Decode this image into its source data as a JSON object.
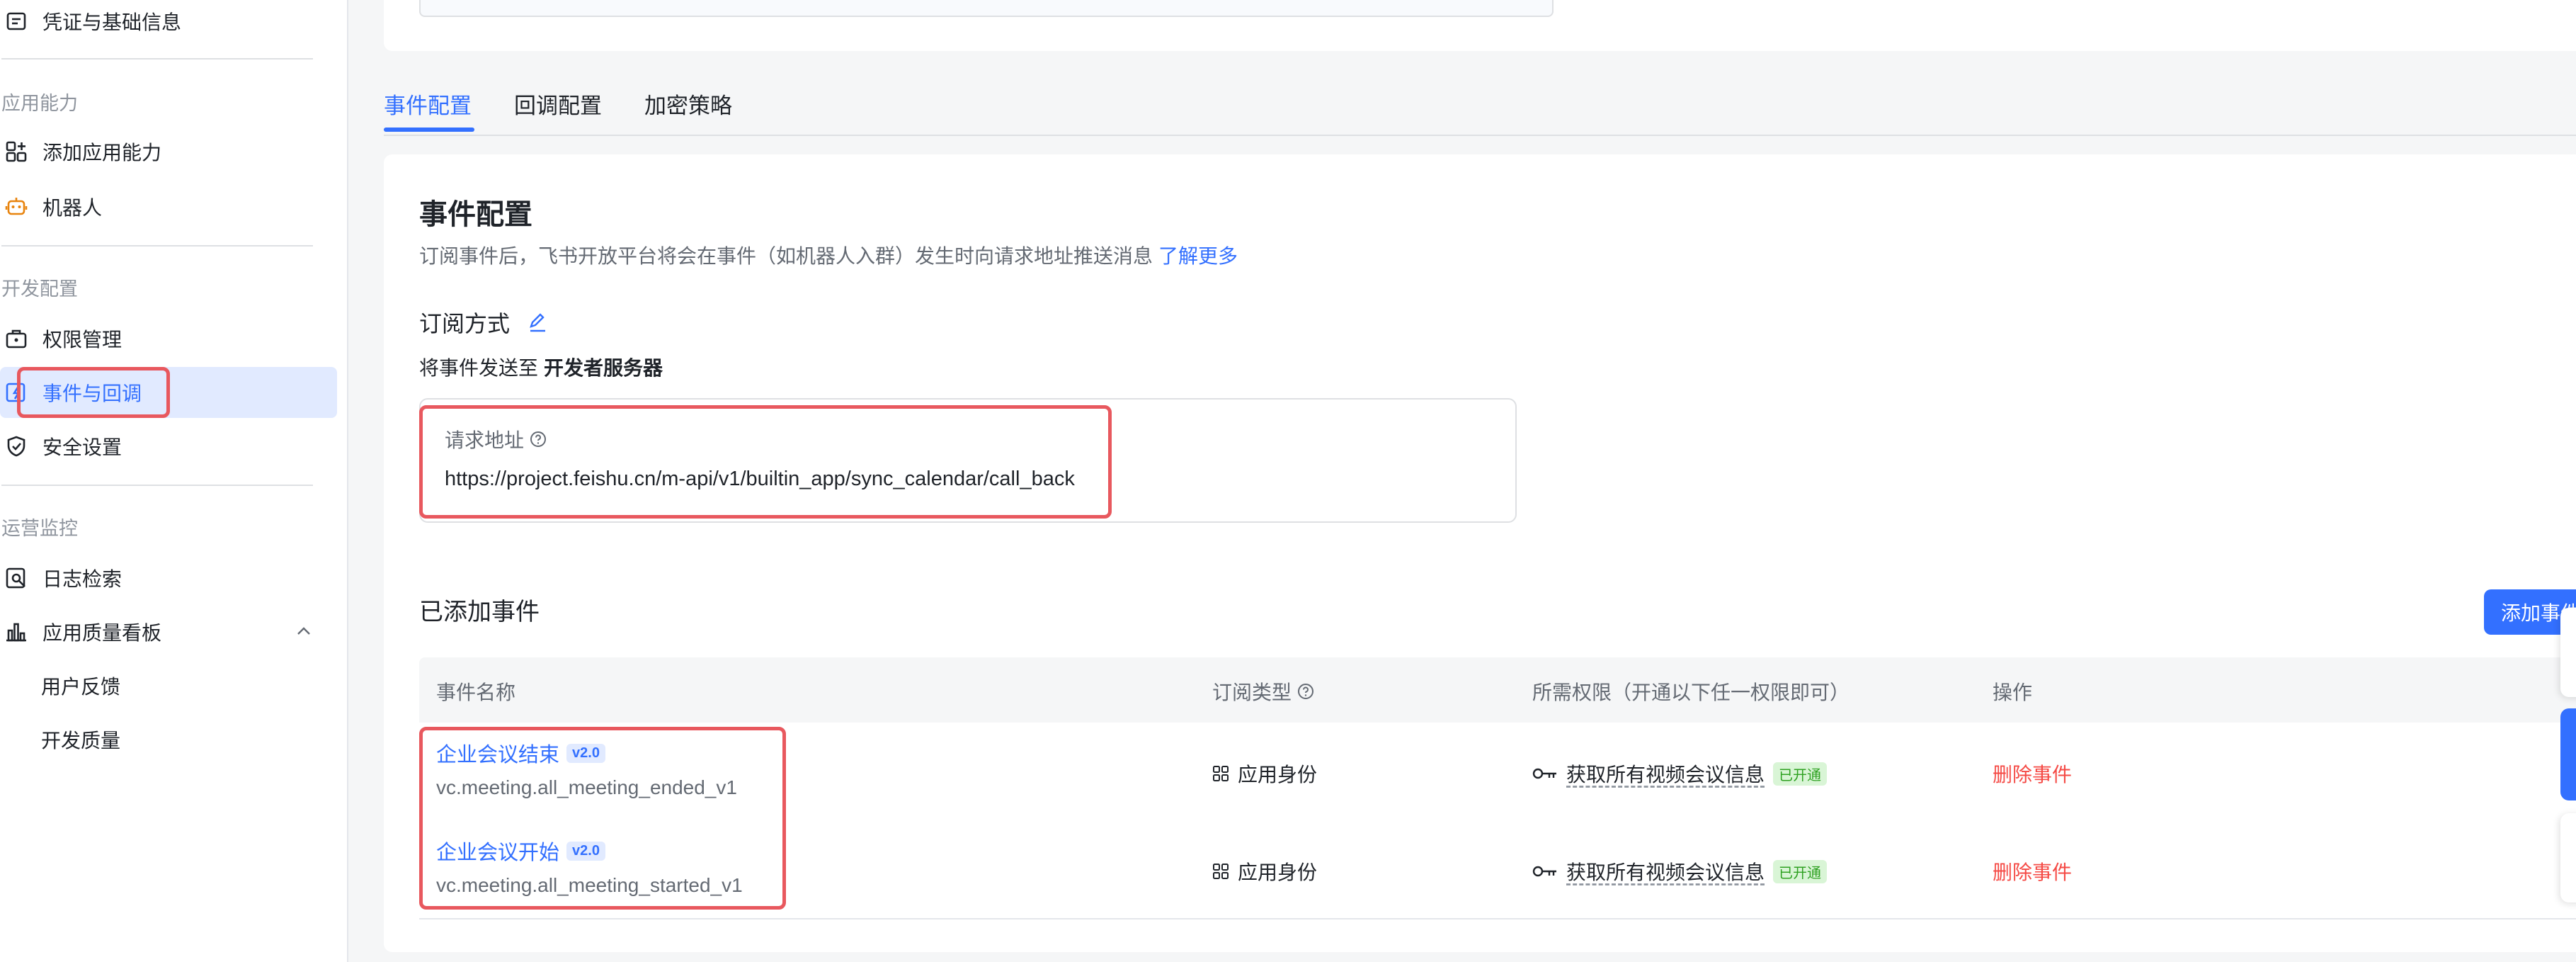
{
  "sidebar": {
    "top_item": "凭证与基础信息",
    "groups": [
      {
        "label": "应用能力",
        "items": [
          "添加应用能力",
          "机器人"
        ]
      },
      {
        "label": "开发配置",
        "items": [
          "权限管理",
          "事件与回调",
          "安全设置"
        ]
      },
      {
        "label": "运营监控",
        "items": [
          "日志检索",
          "应用质量看板",
          "用户反馈",
          "开发质量"
        ]
      }
    ],
    "active_item": "事件与回调"
  },
  "tabs": [
    "事件配置",
    "回调配置",
    "加密策略"
  ],
  "active_tab": "事件配置",
  "section": {
    "title": "事件配置",
    "description": "订阅事件后，飞书开放平台将会在事件（如机器人入群）发生时向请求地址推送消息",
    "learn_more": "了解更多",
    "subscription_title": "订阅方式",
    "send_prefix": "将事件发送至",
    "send_target": "开发者服务器",
    "url_label": "请求地址",
    "url_value": "https://project.feishu.cn/m-api/v1/builtin_app/sync_calendar/call_back"
  },
  "events": {
    "title": "已添加事件",
    "add_button": "添加事件",
    "columns": [
      "事件名称",
      "订阅类型",
      "所需权限（开通以下任一权限即可）",
      "操作"
    ],
    "rows": [
      {
        "name": "企业会议结束",
        "version": "v2.0",
        "code": "vc.meeting.all_meeting_ended_v1",
        "type": "应用身份",
        "permission": "获取所有视频会议信息",
        "status": "已开通",
        "action": "删除事件"
      },
      {
        "name": "企业会议开始",
        "version": "v2.0",
        "code": "vc.meeting.all_meeting_started_v1",
        "type": "应用身份",
        "permission": "获取所有视频会议信息",
        "status": "已开通",
        "action": "删除事件"
      }
    ]
  },
  "colors": {
    "accent": "#3370ff",
    "danger": "#f54a45",
    "highlight": "#e8585e",
    "success": "#2ea121"
  }
}
